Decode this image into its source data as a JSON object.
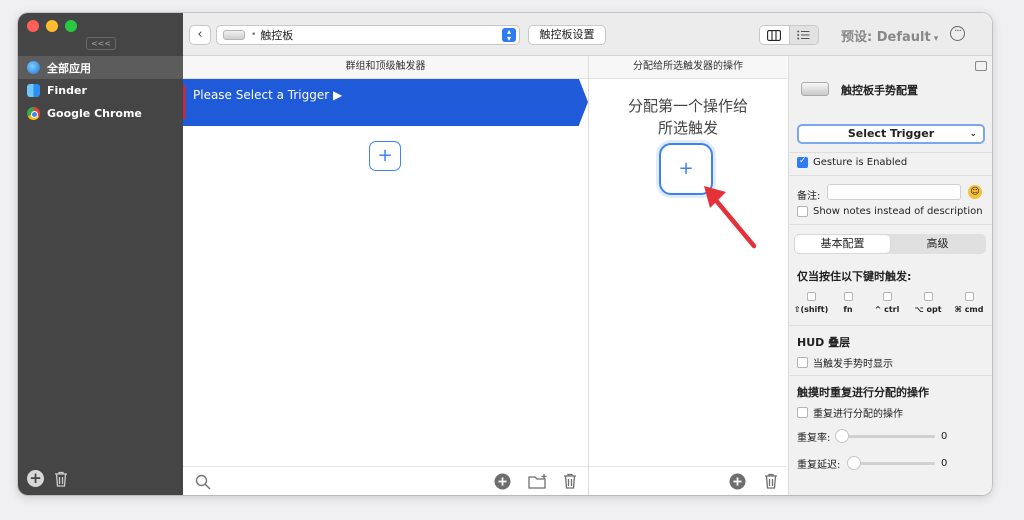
{
  "sidebar": {
    "collapse_label": "<<<",
    "apps": [
      {
        "label": "全部应用",
        "icon": "globe-icon",
        "selected": true
      },
      {
        "label": "Finder",
        "icon": "finder-icon",
        "selected": false
      },
      {
        "label": "Google Chrome",
        "icon": "chrome-icon",
        "selected": false
      }
    ]
  },
  "toolbar": {
    "device_label": "触控板",
    "settings_label": "触控板设置",
    "preset_label": "预设: Default",
    "preset_caret": "▾"
  },
  "triggers": {
    "header": "群组和顶级触发器",
    "selected_row_label": "Please Select a Trigger ▶",
    "add_label": "+"
  },
  "actions": {
    "header": "分配给所选触发器的操作",
    "empty_line1": "分配第一个操作给",
    "empty_line2": "所选触发",
    "add_label": "+"
  },
  "config": {
    "title": "触控板手势配置",
    "select_trigger_label": "Select Trigger",
    "gesture_enabled_label": "Gesture is Enabled",
    "gesture_enabled": true,
    "notes_label": "备注:",
    "notes_value": "",
    "show_notes_label": "Show notes instead of description",
    "tabs": [
      "基本配置",
      "高级"
    ],
    "active_tab": 0,
    "modifier_title": "仅当按住以下键时触发:",
    "modifiers": [
      "⇧(shift)",
      "fn",
      "^ ctrl",
      "⌥ opt",
      "⌘ cmd"
    ],
    "hud_title": "HUD 叠层",
    "hud_checkbox_label": "当触发手势时显示",
    "repeat_title": "触摸时重复进行分配的操作",
    "repeat_checkbox_label": "重复进行分配的操作",
    "repeat_rate_label": "重复率:",
    "repeat_rate_value": "0",
    "repeat_delay_label": "重复延迟:",
    "repeat_delay_value": "0"
  },
  "colors": {
    "accent": "#3b82f6",
    "selection": "#1f5bd8",
    "annotation_arrow": "#e5323a",
    "sidebar_bg": "#454545"
  }
}
